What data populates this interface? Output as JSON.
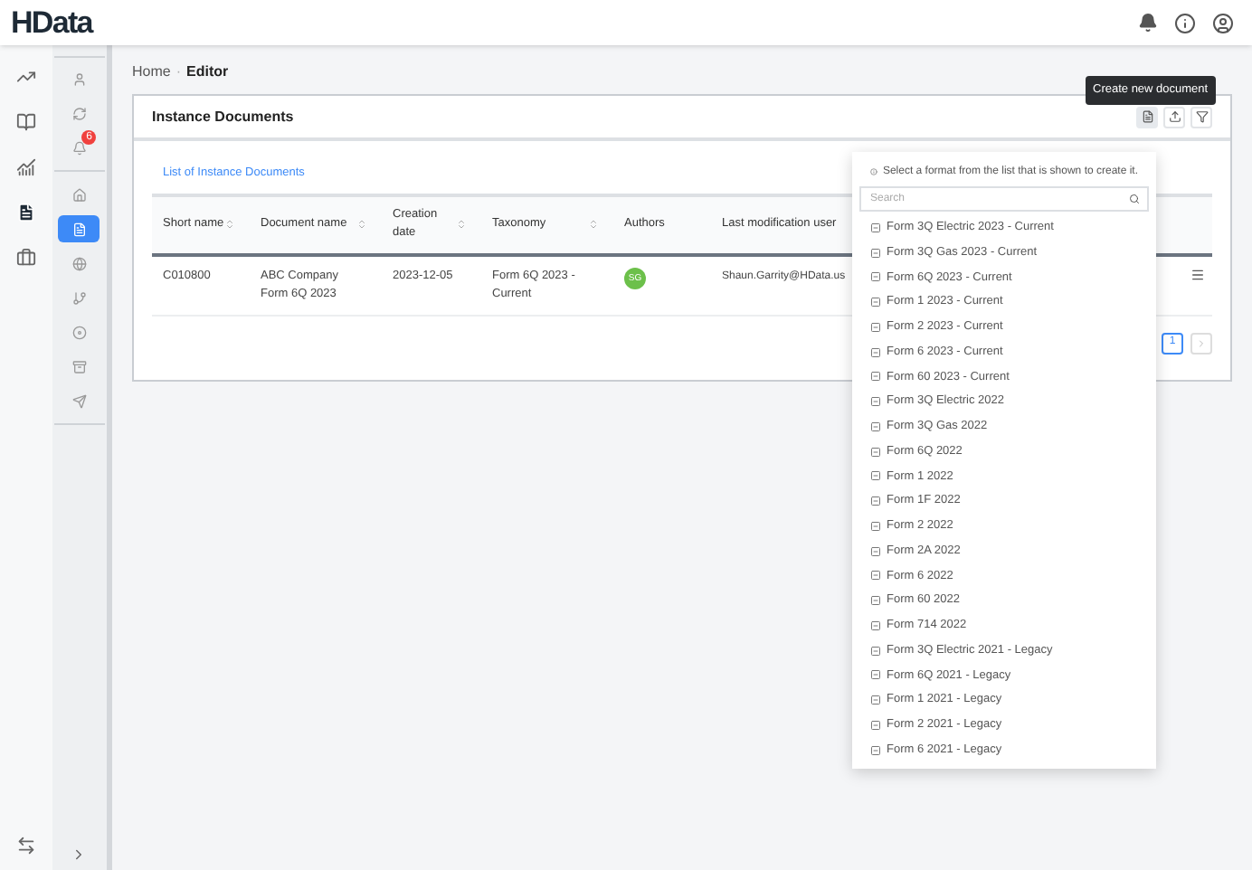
{
  "header": {
    "logo": "HData"
  },
  "rail": [
    {
      "selected": false
    },
    {
      "selected": false
    },
    {
      "selected": false
    },
    {
      "selected": true
    },
    {
      "selected": false
    }
  ],
  "subnav": [
    {
      "selected": false
    },
    {
      "selected": false
    },
    {
      "selected": false,
      "badge": "6"
    },
    {
      "selected": false
    },
    {
      "selected": true
    },
    {
      "selected": false
    },
    {
      "selected": false
    },
    {
      "selected": false
    },
    {
      "selected": false
    },
    {
      "selected": false
    }
  ],
  "breadcrumb": {
    "items": [
      "Home",
      "Editor"
    ],
    "separator": "·"
  },
  "card": {
    "title": "Instance Documents",
    "tab": "List of Instance Documents"
  },
  "tooltip": "Create new document",
  "table": {
    "columns": [
      {
        "label": "Short name",
        "sortable": true
      },
      {
        "label": "Document name",
        "sortable": true
      },
      {
        "label": "Creation date",
        "sortable": true
      },
      {
        "label": "Taxonomy",
        "sortable": true
      },
      {
        "label": "Authors",
        "sortable": false
      },
      {
        "label": "Last modification user",
        "sortable": false
      }
    ],
    "rows": [
      {
        "cells": [
          "C010800",
          "ABC Company Form 6Q 2023",
          "2023-12-05",
          "Form 6Q 2023 - Current"
        ],
        "author": "SG",
        "user": "Shaun.Garrity@HData.us"
      }
    ]
  },
  "pagination": {
    "page": "1",
    "selected": true
  },
  "dropdown": {
    "hint": "Select a format from the list that is shown to create it.",
    "search": {
      "placeholder": "Search"
    },
    "items": [
      "Form 3Q Electric 2023 - Current",
      "Form 3Q Gas 2023 - Current",
      "Form 6Q 2023 - Current",
      "Form 1 2023 - Current",
      "Form 2 2023 - Current",
      "Form 6 2023 - Current",
      "Form 60 2023 - Current",
      "Form 3Q Electric 2022",
      "Form 3Q Gas 2022",
      "Form 6Q 2022",
      "Form 1 2022",
      "Form 1F 2022",
      "Form 2 2022",
      "Form 2A 2022",
      "Form 6 2022",
      "Form 60 2022",
      "Form 714 2022",
      "Form 3Q Electric 2021 - Legacy",
      "Form 6Q 2021 - Legacy",
      "Form 1 2021 - Legacy",
      "Form 2 2021 - Legacy",
      "Form 6 2021 - Legacy"
    ]
  }
}
